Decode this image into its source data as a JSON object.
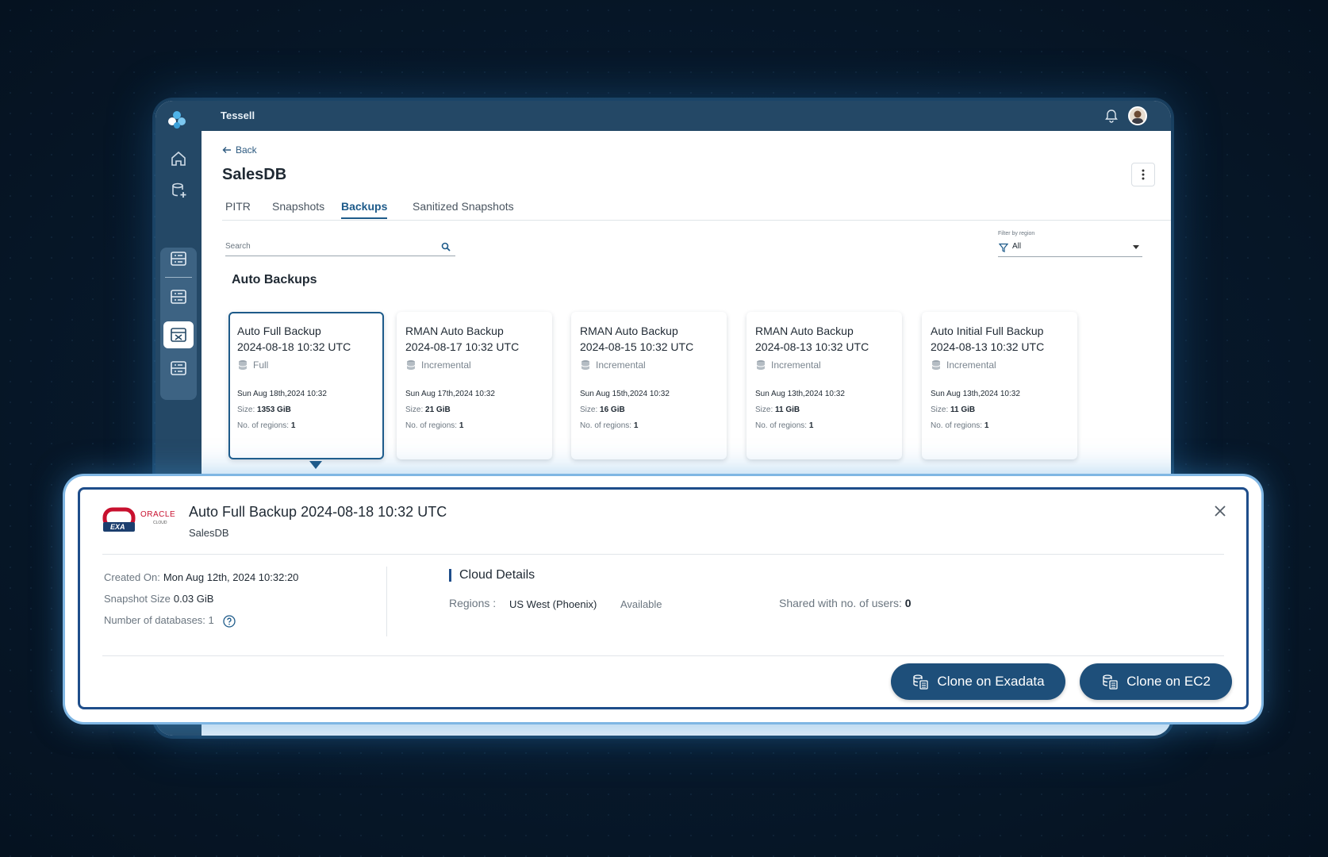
{
  "app": {
    "title": "Tessell"
  },
  "header": {
    "back_label": "Back",
    "page_title": "SalesDB"
  },
  "tabs": [
    {
      "label": "PITR",
      "active": false
    },
    {
      "label": "Snapshots",
      "active": false
    },
    {
      "label": "Backups",
      "active": true
    },
    {
      "label": "Sanitized Snapshots",
      "active": false
    }
  ],
  "search": {
    "label": "Search"
  },
  "filter": {
    "label": "Filter by region",
    "value": "All"
  },
  "section": {
    "title": "Auto Backups"
  },
  "cards": [
    {
      "title_line1": "Auto Full Backup",
      "title_line2": "2024-08-18 10:32 UTC",
      "type": "Full",
      "date": "Sun Aug 18th,2024 10:32",
      "size_label": "Size:",
      "size": "1353 GiB",
      "regions_label": "No. of regions:",
      "regions": "1",
      "selected": true
    },
    {
      "title_line1": "RMAN Auto Backup",
      "title_line2": "2024-08-17 10:32 UTC",
      "type": "Incremental",
      "date": "Sun Aug 17th,2024 10:32",
      "size_label": "Size:",
      "size": "21 GiB",
      "regions_label": "No. of regions:",
      "regions": "1",
      "selected": false
    },
    {
      "title_line1": "RMAN Auto Backup",
      "title_line2": "2024-08-15 10:32 UTC",
      "type": "Incremental",
      "date": "Sun Aug 15th,2024 10:32",
      "size_label": "Size:",
      "size": "16 GiB",
      "regions_label": "No. of regions:",
      "regions": "1",
      "selected": false
    },
    {
      "title_line1": "RMAN Auto Backup",
      "title_line2": "2024-08-13 10:32 UTC",
      "type": "Incremental",
      "date": "Sun Aug 13th,2024 10:32",
      "size_label": "Size:",
      "size": "11 GiB",
      "regions_label": "No. of regions:",
      "regions": "1",
      "selected": false
    },
    {
      "title_line1": "Auto Initial Full Backup",
      "title_line2": "2024-08-13 10:32 UTC",
      "type": "Incremental",
      "date": "Sun Aug 13th,2024 10:32",
      "size_label": "Size:",
      "size": "11 GiB",
      "regions_label": "No. of regions:",
      "regions": "1",
      "selected": false
    }
  ],
  "detail": {
    "logo_exa": "EXA",
    "logo_oracle": "ORACLE",
    "logo_cloud": "CLOUD",
    "title": "Auto Full Backup 2024-08-18 10:32 UTC",
    "subtitle": "SalesDB",
    "created_label": "Created On:",
    "created_value": "Mon Aug 12th, 2024 10:32:20",
    "snapshot_size_label": "Snapshot Size",
    "snapshot_size_value": "0.03 GiB",
    "num_db_label": "Number of databases:",
    "num_db_value": "1",
    "cloud_title": "Cloud Details",
    "regions_label": "Regions :",
    "region_value": "US West (Phoenix)",
    "region_status": "Available",
    "shared_label": "Shared with no. of users:",
    "shared_value": "0",
    "btn_exadata": "Clone on Exadata",
    "btn_ec2": "Clone on EC2"
  },
  "colors": {
    "brand_navy": "#244866",
    "accent": "#1e5b8a",
    "button": "#1e4f7a",
    "oracle_red": "#c8102e"
  }
}
